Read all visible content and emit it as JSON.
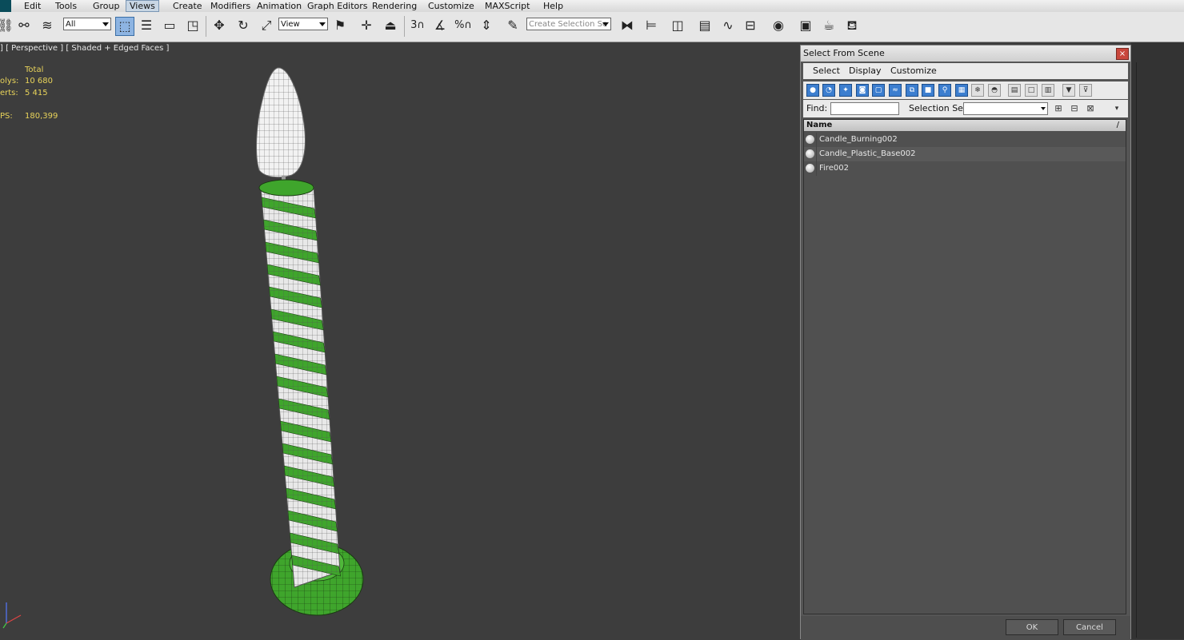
{
  "menubar": {
    "items": [
      "Edit",
      "Tools",
      "Group",
      "Views",
      "Create",
      "Modifiers",
      "Animation",
      "Graph Editors",
      "Rendering",
      "Customize",
      "MAXScript",
      "Help"
    ],
    "active": "Views"
  },
  "toolbar": {
    "filter_combo": "All",
    "ref_coord_combo": "View",
    "selection_set_combo": "Create Selection Se",
    "snap_label": "3"
  },
  "viewport": {
    "label": "] [ Perspective ] [ Shaded + Edged Faces ]",
    "stats_header": "Total",
    "stats": [
      {
        "label": "olys:",
        "value": "10 680"
      },
      {
        "label": "erts:",
        "value": "5 415"
      },
      {
        "label": "PS:",
        "value": "180,399"
      }
    ]
  },
  "dialog": {
    "title": "Select From Scene",
    "close": "×",
    "menu": [
      "Select",
      "Display",
      "Customize"
    ],
    "find_label": "Find:",
    "find_value": "",
    "selset_label": "Selection Set:",
    "selset_value": "",
    "column_name": "Name",
    "sort_mark": "/",
    "objects": [
      "Candle_Burning002",
      "Candle_Plastic_Base002",
      "Fire002"
    ],
    "ok": "OK",
    "cancel": "Cancel"
  },
  "colors": {
    "viewport_bg": "#3d3d3d",
    "candle_green": "#3fa52c",
    "candle_white": "#e8e8e8",
    "stats_yellow": "#e8d35a",
    "filter_active": "#3c7ecf"
  }
}
